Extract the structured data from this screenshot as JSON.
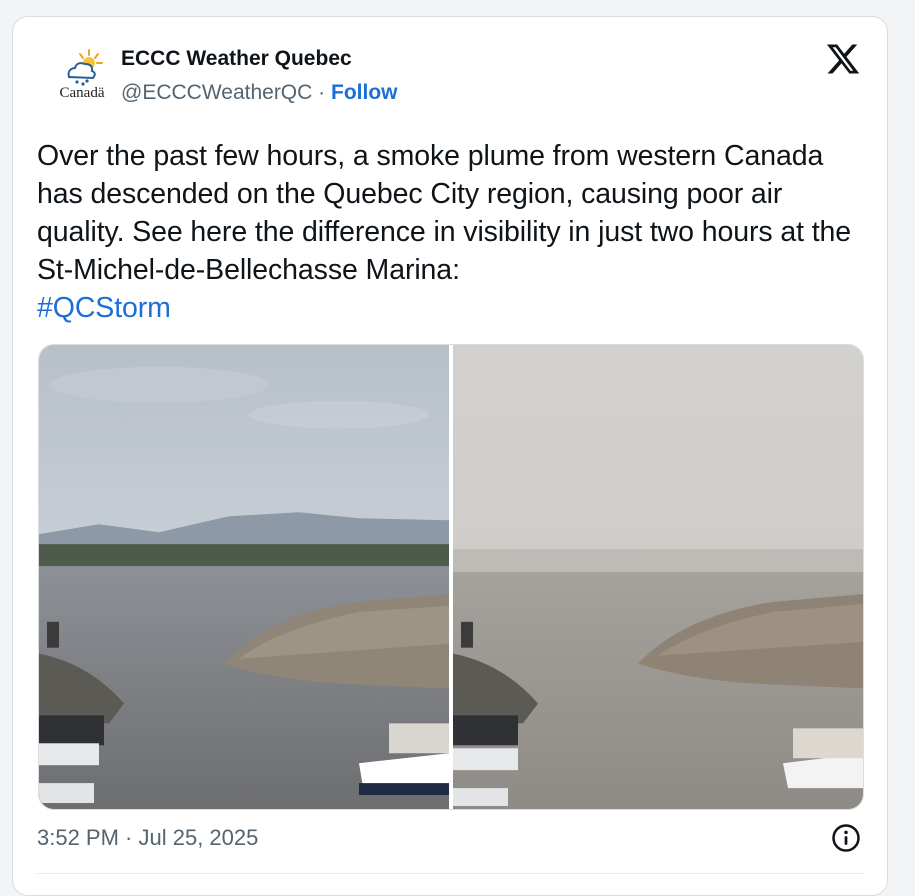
{
  "account": {
    "display_name": "ECCC Weather Quebec",
    "handle": "@ECCCWeatherQC",
    "separator": "·",
    "follow_label": "Follow",
    "logo_text": "Canadä"
  },
  "tweet": {
    "text": "Over the past few hours, a smoke plume from western Canada has descended on the Quebec City region, causing poor air quality. See here the difference in visibility in just two hours at the St-Michel-de-Bellechasse Marina:",
    "hashtag": "#QCStorm"
  },
  "media": {
    "images": [
      {
        "description": "marina-clear-sky"
      },
      {
        "description": "marina-smoke-haze"
      }
    ]
  },
  "meta": {
    "timestamp": "3:52 PM · Jul 25, 2025"
  },
  "icons": {
    "platform": "x-logo-icon",
    "info": "info-icon",
    "logo": "weather-cloud-sun-icon"
  },
  "colors": {
    "link": "#1d6fd8",
    "secondary_text": "#536471",
    "primary_text": "#0f1419"
  }
}
